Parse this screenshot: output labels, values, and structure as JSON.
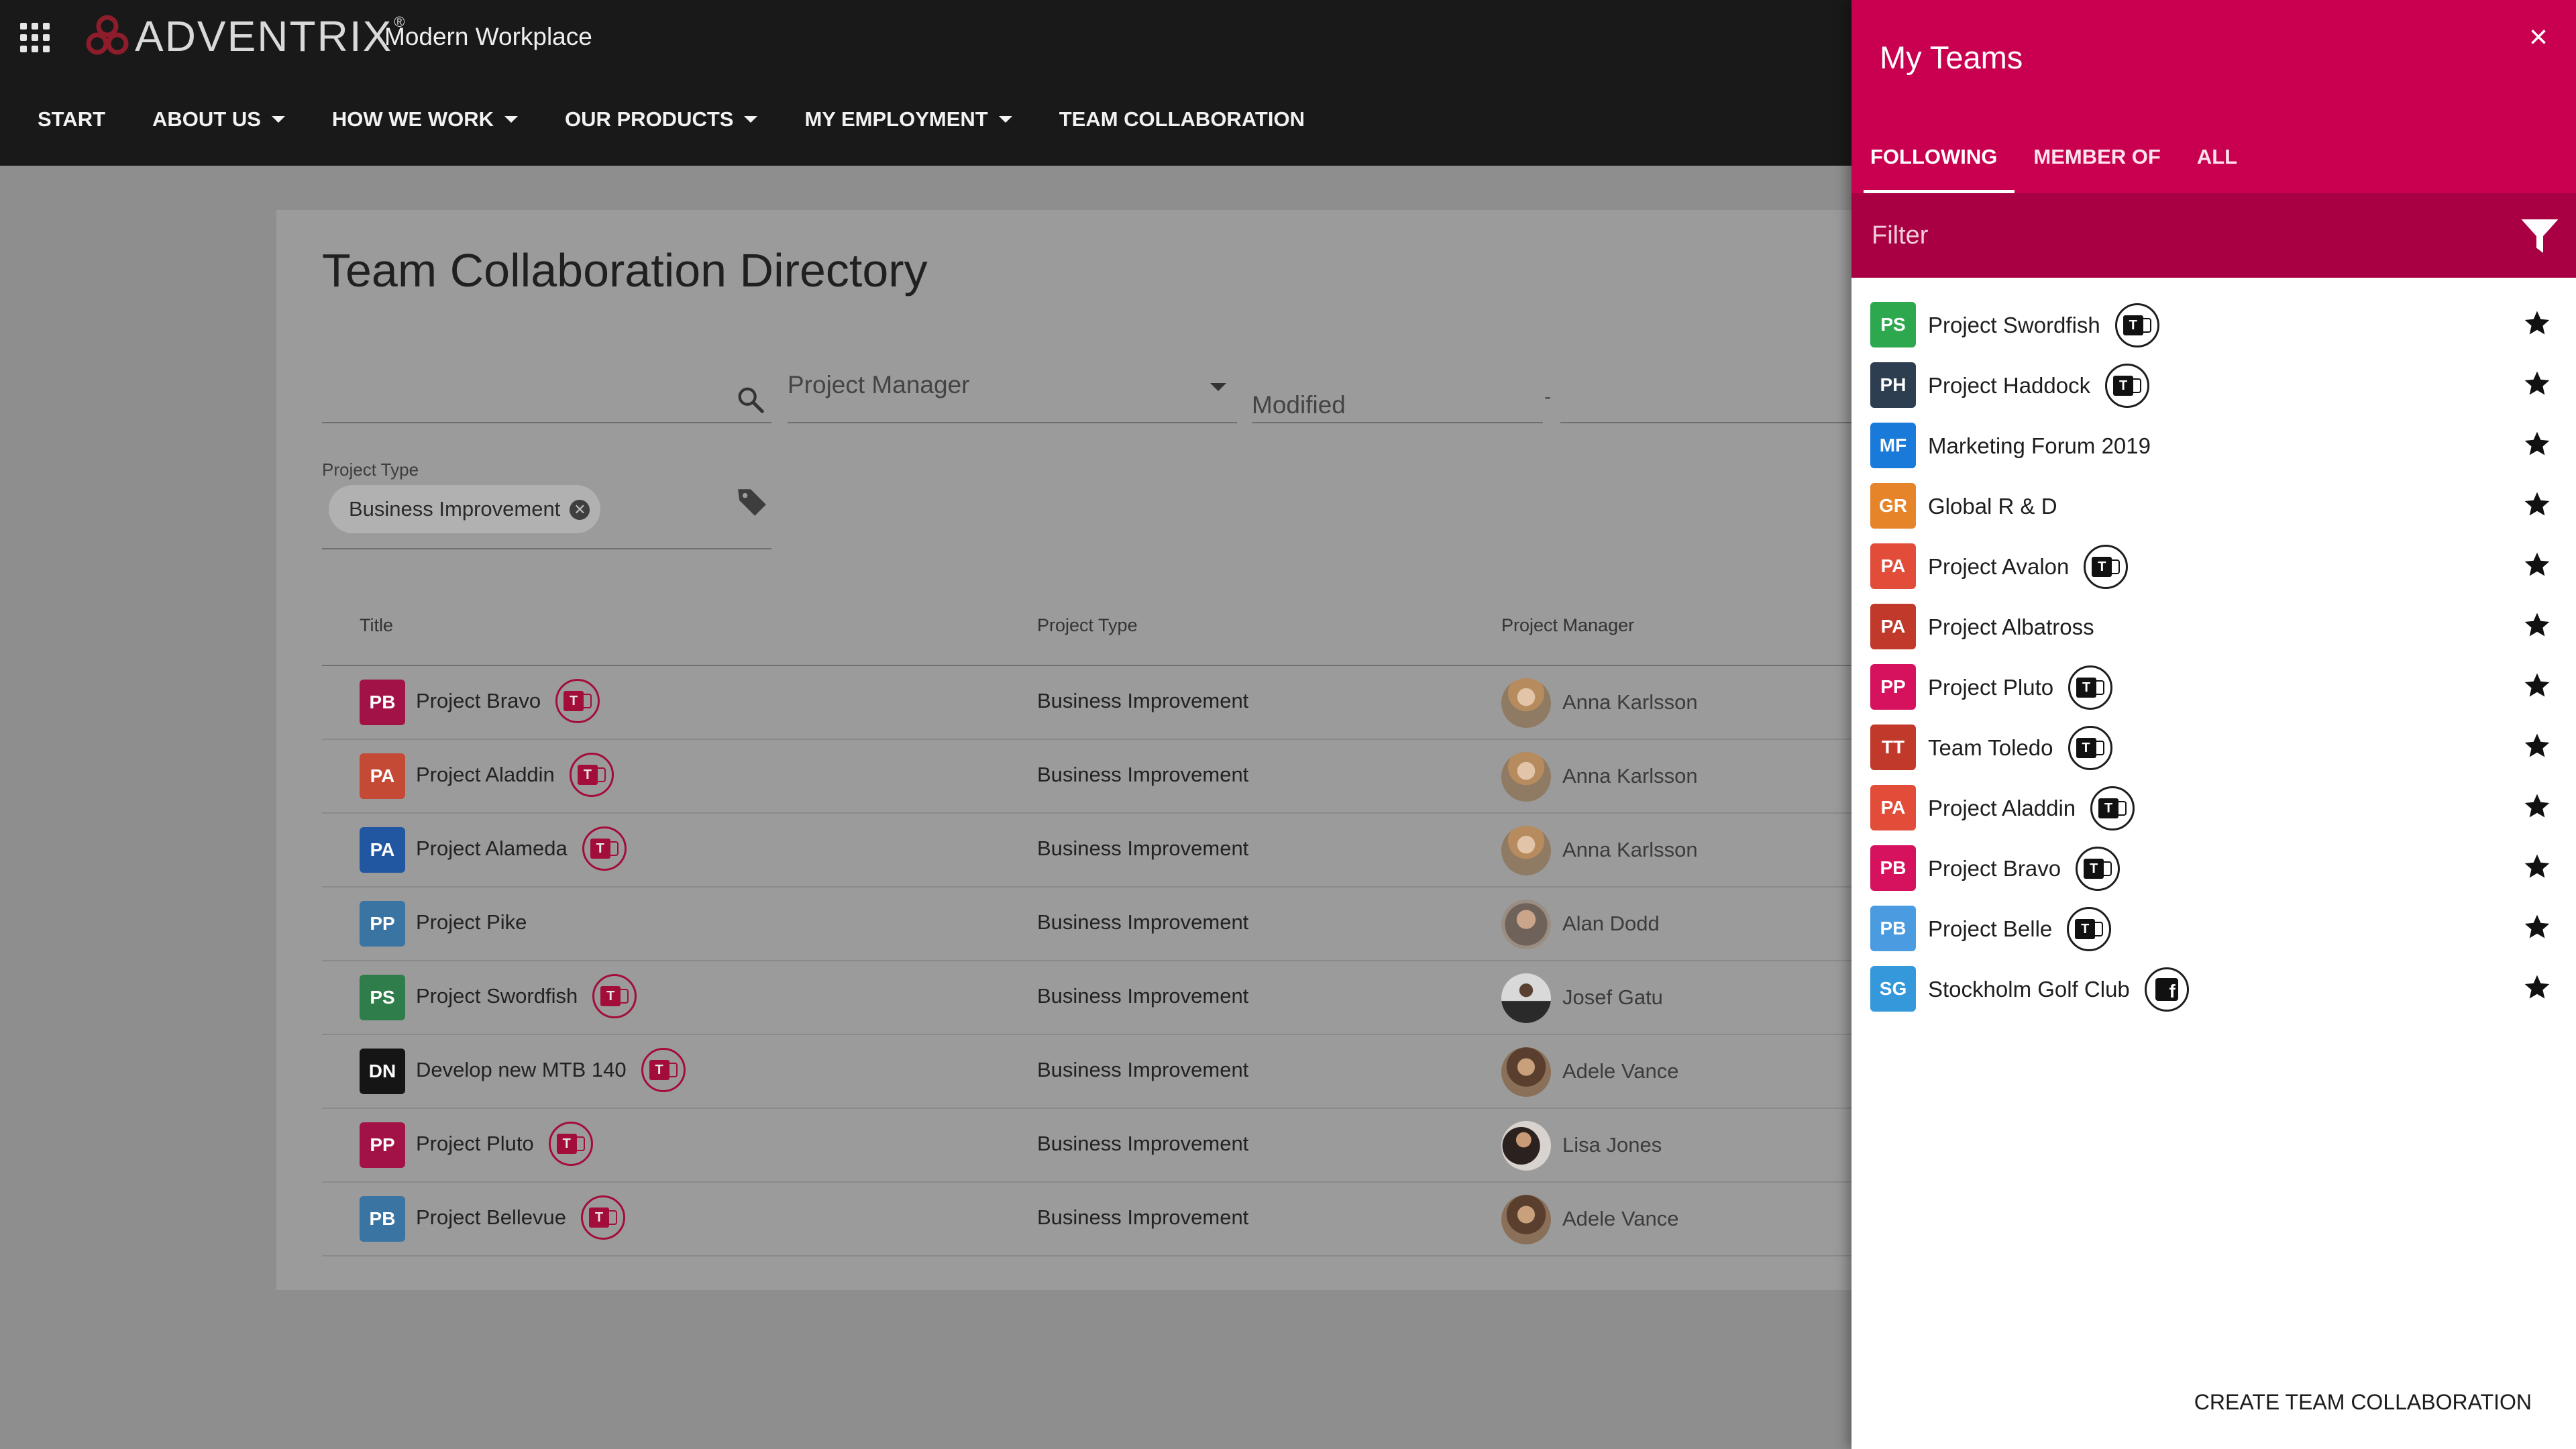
{
  "header": {
    "logo_text": "ADVENTRIX",
    "logo_reg": "®",
    "site_name": "Modern Workplace",
    "nav": [
      {
        "label": "START",
        "dropdown": false
      },
      {
        "label": "ABOUT US",
        "dropdown": true
      },
      {
        "label": "HOW WE WORK",
        "dropdown": true
      },
      {
        "label": "OUR PRODUCTS",
        "dropdown": true
      },
      {
        "label": "MY EMPLOYMENT",
        "dropdown": true
      },
      {
        "label": "TEAM COLLABORATION",
        "dropdown": false
      }
    ]
  },
  "directory": {
    "title": "Team Collaboration Directory",
    "search": {
      "placeholder": ""
    },
    "project_manager_label": "Project Manager",
    "modified_label": "Modified",
    "modified_separator": "-",
    "project_type_label": "Project Type",
    "project_type_chip": "Business Improvement",
    "columns": {
      "title": "Title",
      "project_type": "Project Type",
      "project_manager": "Project Manager"
    },
    "rows": [
      {
        "initials": "PB",
        "color": "#a31246",
        "title": "Project Bravo",
        "teams": true,
        "project_type": "Business Improvement",
        "manager": "Anna Karlsson",
        "photo": "anna"
      },
      {
        "initials": "PA",
        "color": "#c44a36",
        "title": "Project Aladdin",
        "teams": true,
        "project_type": "Business Improvement",
        "manager": "Anna Karlsson",
        "photo": "anna"
      },
      {
        "initials": "PA",
        "color": "#2157a0",
        "title": "Project Alameda",
        "teams": true,
        "project_type": "Business Improvement",
        "manager": "Anna Karlsson",
        "photo": "anna"
      },
      {
        "initials": "PP",
        "color": "#3a74a3",
        "title": "Project Pike",
        "teams": false,
        "project_type": "Business Improvement",
        "manager": "Alan Dodd",
        "photo": "alan"
      },
      {
        "initials": "PS",
        "color": "#2e7d4a",
        "title": "Project Swordfish",
        "teams": true,
        "project_type": "Business Improvement",
        "manager": "Josef Gatu",
        "photo": "josef"
      },
      {
        "initials": "DN",
        "color": "#151515",
        "title": "Develop new MTB 140",
        "teams": true,
        "project_type": "Business Improvement",
        "manager": "Adele Vance",
        "photo": "adele"
      },
      {
        "initials": "PP",
        "color": "#a31246",
        "title": "Project Pluto",
        "teams": true,
        "project_type": "Business Improvement",
        "manager": "Lisa Jones",
        "photo": "lisa"
      },
      {
        "initials": "PB",
        "color": "#3a74a3",
        "title": "Project Bellevue",
        "teams": true,
        "project_type": "Business Improvement",
        "manager": "Adele Vance",
        "photo": "adele"
      }
    ]
  },
  "panel": {
    "title": "My Teams",
    "close_label": "×",
    "tabs": [
      {
        "label": "FOLLOWING",
        "active": true
      },
      {
        "label": "MEMBER OF",
        "active": false
      },
      {
        "label": "ALL",
        "active": false
      }
    ],
    "filter_placeholder": "Filter",
    "teams": [
      {
        "initials": "PS",
        "color": "#2ea84f",
        "name": "Project Swordfish",
        "badge": "teams"
      },
      {
        "initials": "PH",
        "color": "#2c3e50",
        "name": "Project Haddock",
        "badge": "teams"
      },
      {
        "initials": "MF",
        "color": "#1a7ad9",
        "name": "Marketing Forum 2019",
        "badge": "none"
      },
      {
        "initials": "GR",
        "color": "#e6842a",
        "name": "Global R & D",
        "badge": "none"
      },
      {
        "initials": "PA",
        "color": "#e24d3a",
        "name": "Project Avalon",
        "badge": "teams"
      },
      {
        "initials": "PA",
        "color": "#c0392b",
        "name": "Project Albatross",
        "badge": "none"
      },
      {
        "initials": "PP",
        "color": "#d6125f",
        "name": "Project Pluto",
        "badge": "teams"
      },
      {
        "initials": "TT",
        "color": "#c0392b",
        "name": "Team Toledo",
        "badge": "teams"
      },
      {
        "initials": "PA",
        "color": "#e24d3a",
        "name": "Project Aladdin",
        "badge": "teams"
      },
      {
        "initials": "PB",
        "color": "#d6125f",
        "name": "Project Bravo",
        "badge": "teams"
      },
      {
        "initials": "PB",
        "color": "#4a9be0",
        "name": "Project Belle",
        "badge": "teams"
      },
      {
        "initials": "SG",
        "color": "#3498db",
        "name": "Stockholm Golf Club",
        "badge": "facebook"
      }
    ],
    "create_label": "CREATE TEAM COLLABORATION"
  },
  "colors": {
    "panel_accent": "#c8004f",
    "filter_bar": "#a80043",
    "topbar": "#191919",
    "overlay_bg": "#8e8e8e"
  },
  "icons": {
    "menu": "app-launcher-icon",
    "search": "search-icon",
    "tag": "tag-icon",
    "filter": "filter-icon",
    "star": "star-icon",
    "close": "close-icon",
    "teams": "ms-teams-icon",
    "facebook": "facebook-icon"
  }
}
